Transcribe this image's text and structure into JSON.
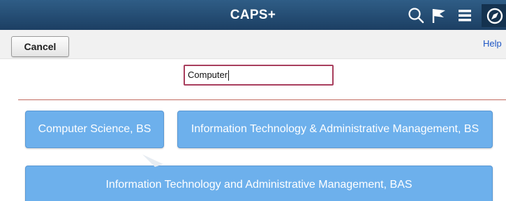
{
  "header": {
    "title": "CAPS+",
    "icons": [
      "search-icon",
      "flag-icon",
      "menu-icon",
      "compass-icon"
    ]
  },
  "toolbar": {
    "cancel_label": "Cancel",
    "help_label": "Help"
  },
  "search": {
    "value": "Computer"
  },
  "results": [
    {
      "label": "Computer Science, BS"
    },
    {
      "label": "Information Technology & Administrative Management, BS"
    },
    {
      "label": "Information Technology and Administrative Management, BAS"
    }
  ],
  "colors": {
    "header_top": "#2f5d86",
    "header_bottom": "#1c3f63",
    "tile": "#6db0ec",
    "input_border": "#a83e5d",
    "divider": "#c26a5e",
    "link": "#1f57c5"
  }
}
